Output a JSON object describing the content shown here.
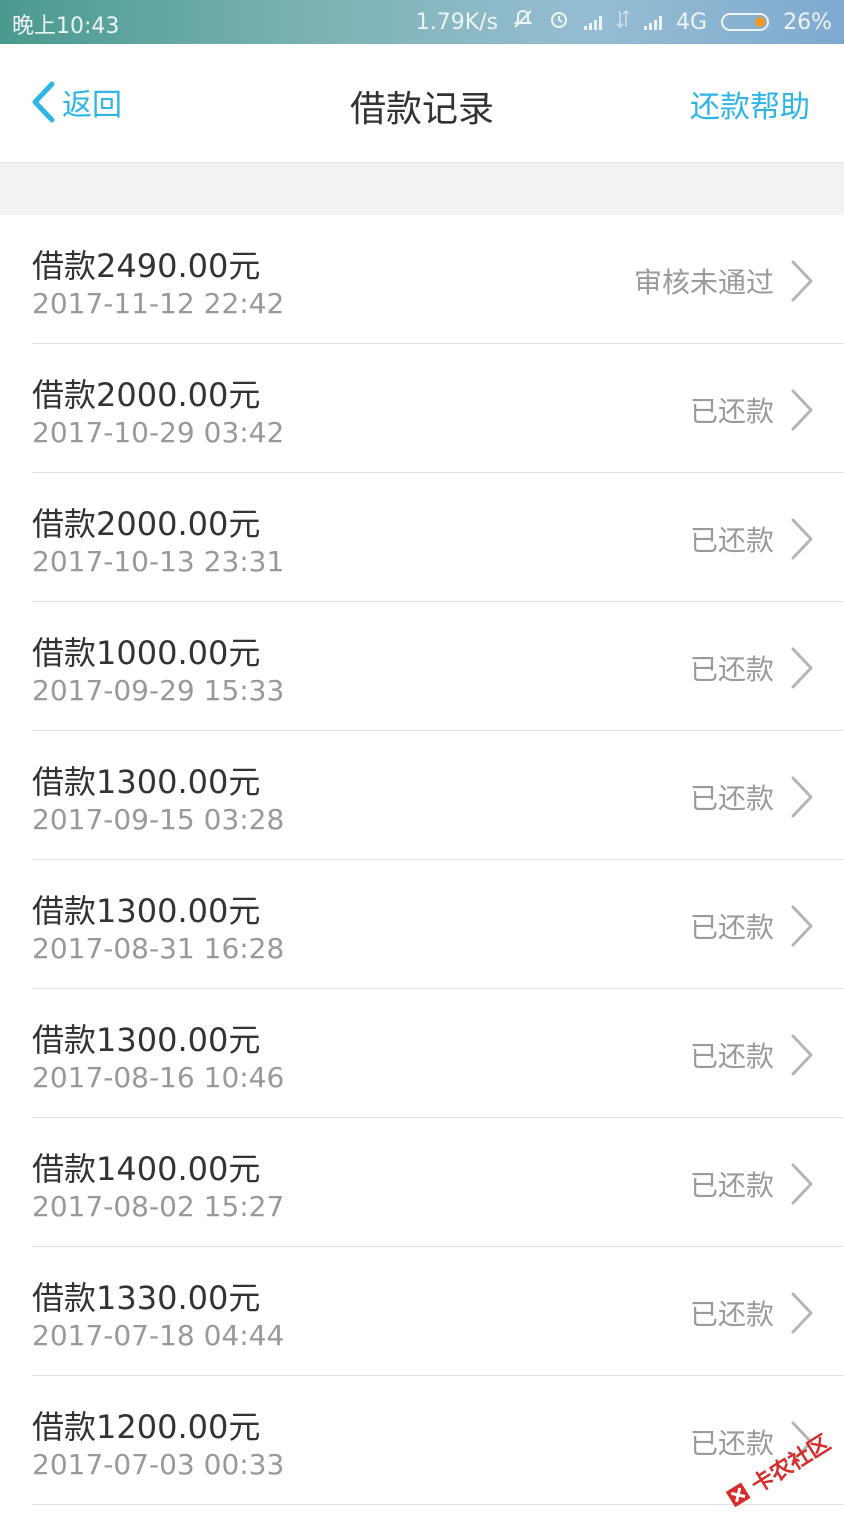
{
  "status_bar": {
    "time": "晚上10:43",
    "speed": "1.79K/s",
    "network": "4G",
    "battery": "26%",
    "battery_level": 0.26
  },
  "nav": {
    "back_label": "返回",
    "title": "借款记录",
    "help_label": "还款帮助"
  },
  "records": [
    {
      "amount": "借款2490.00元",
      "date": "2017-11-12 22:42",
      "status": "审核未通过"
    },
    {
      "amount": "借款2000.00元",
      "date": "2017-10-29 03:42",
      "status": "已还款"
    },
    {
      "amount": "借款2000.00元",
      "date": "2017-10-13 23:31",
      "status": "已还款"
    },
    {
      "amount": "借款1000.00元",
      "date": "2017-09-29 15:33",
      "status": "已还款"
    },
    {
      "amount": "借款1300.00元",
      "date": "2017-09-15 03:28",
      "status": "已还款"
    },
    {
      "amount": "借款1300.00元",
      "date": "2017-08-31 16:28",
      "status": "已还款"
    },
    {
      "amount": "借款1300.00元",
      "date": "2017-08-16 10:46",
      "status": "已还款"
    },
    {
      "amount": "借款1400.00元",
      "date": "2017-08-02 15:27",
      "status": "已还款"
    },
    {
      "amount": "借款1330.00元",
      "date": "2017-07-18 04:44",
      "status": "已还款"
    },
    {
      "amount": "借款1200.00元",
      "date": "2017-07-03 00:33",
      "status": "已还款"
    }
  ],
  "watermark": {
    "text": "卡农社区"
  },
  "colors": {
    "accent": "#2eb5e6",
    "battery": "#f39a24",
    "watermark": "#d62c2c"
  }
}
